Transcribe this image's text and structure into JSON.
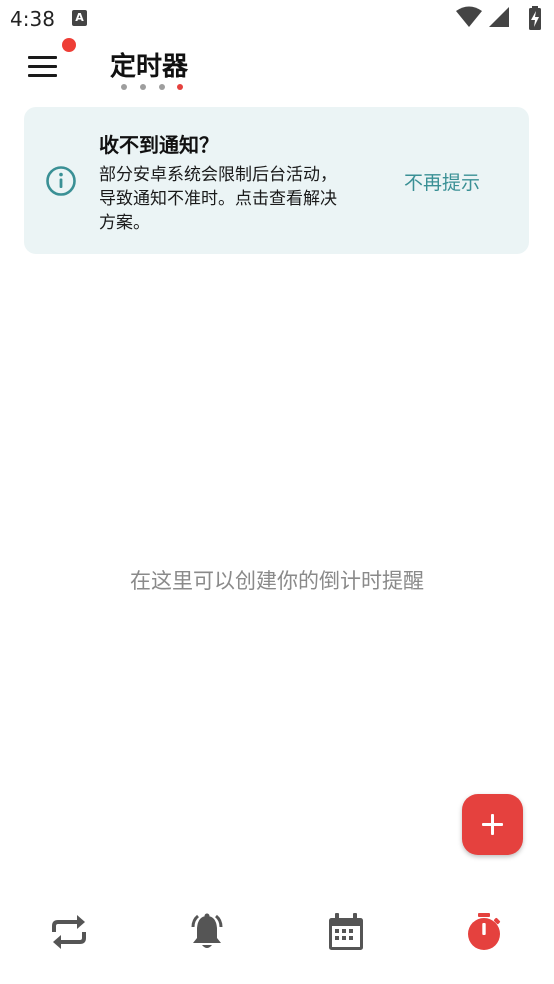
{
  "status_bar": {
    "time": "4:38",
    "notification_icon": "A",
    "icons": [
      "wifi-icon",
      "signal-icon",
      "battery-charging-icon"
    ]
  },
  "app_bar": {
    "title": "定时器",
    "menu_icon": "menu-icon",
    "badge_color": "#ee3e36",
    "page_indicator": {
      "count": 4,
      "active_index": 3
    }
  },
  "notice": {
    "icon": "info-icon",
    "title": "收不到通知？",
    "body_lines": [
      "部分安卓系统会限制后台活动，",
      "导致通知不准时。点击查看解决",
      "方案。"
    ],
    "dismiss_label": "不再提示"
  },
  "empty_state": {
    "text": "在这里可以创建你的倒计时提醒"
  },
  "fab": {
    "icon": "plus-icon",
    "color": "#e5413e"
  },
  "bottom_nav": {
    "items": [
      {
        "icon": "repeat-icon",
        "active": false
      },
      {
        "icon": "alarm-bell-icon",
        "active": false
      },
      {
        "icon": "calendar-icon",
        "active": false
      },
      {
        "icon": "stopwatch-icon",
        "active": true
      }
    ],
    "inactive_color": "#555555",
    "active_color": "#e5413e"
  },
  "colors": {
    "accent": "#e5413e",
    "notice_bg": "#ebf4f5",
    "teal": "#3a9095"
  }
}
